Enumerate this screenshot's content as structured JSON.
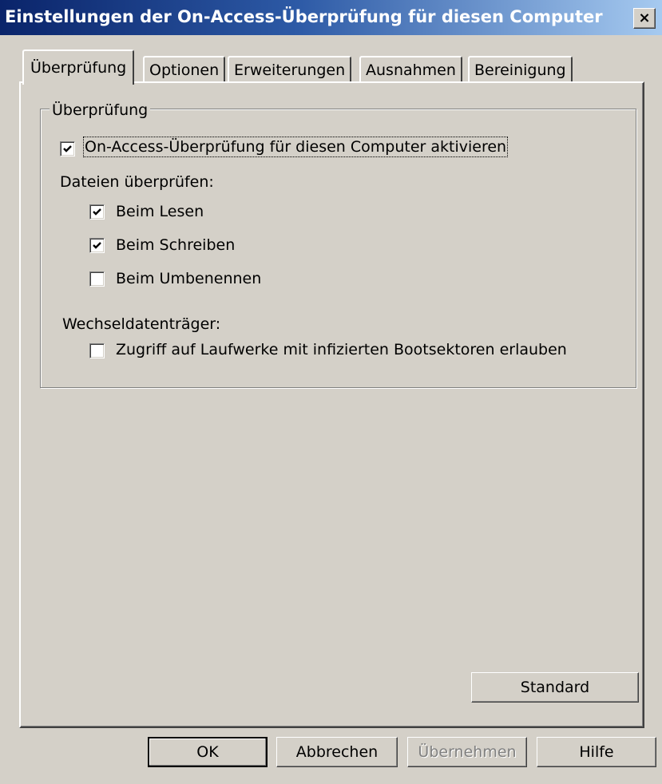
{
  "window": {
    "title": "Einstellungen der On-Access-Überprüfung für diesen Computer",
    "close_label": "×"
  },
  "tabs": [
    {
      "label": "Überprüfung",
      "active": true
    },
    {
      "label": "Optionen"
    },
    {
      "label": "Erweiterungen"
    },
    {
      "label": "Ausnahmen"
    },
    {
      "label": "Bereinigung"
    }
  ],
  "group": {
    "title": "Überprüfung",
    "enable": {
      "label": "On-Access-Überprüfung für diesen Computer aktivieren",
      "checked": true
    },
    "files_label": "Dateien überprüfen:",
    "files": [
      {
        "label": "Beim Lesen",
        "checked": true
      },
      {
        "label": "Beim Schreiben",
        "checked": true
      },
      {
        "label": "Beim Umbenennen",
        "checked": false
      }
    ],
    "removable_label": "Wechseldatenträger:",
    "removable": {
      "label": "Zugriff auf Laufwerke mit infizierten Bootsektoren erlauben",
      "checked": false
    }
  },
  "buttons": {
    "standard": "Standard",
    "ok": "OK",
    "cancel": "Abbrechen",
    "apply": "Übernehmen",
    "help": "Hilfe"
  }
}
